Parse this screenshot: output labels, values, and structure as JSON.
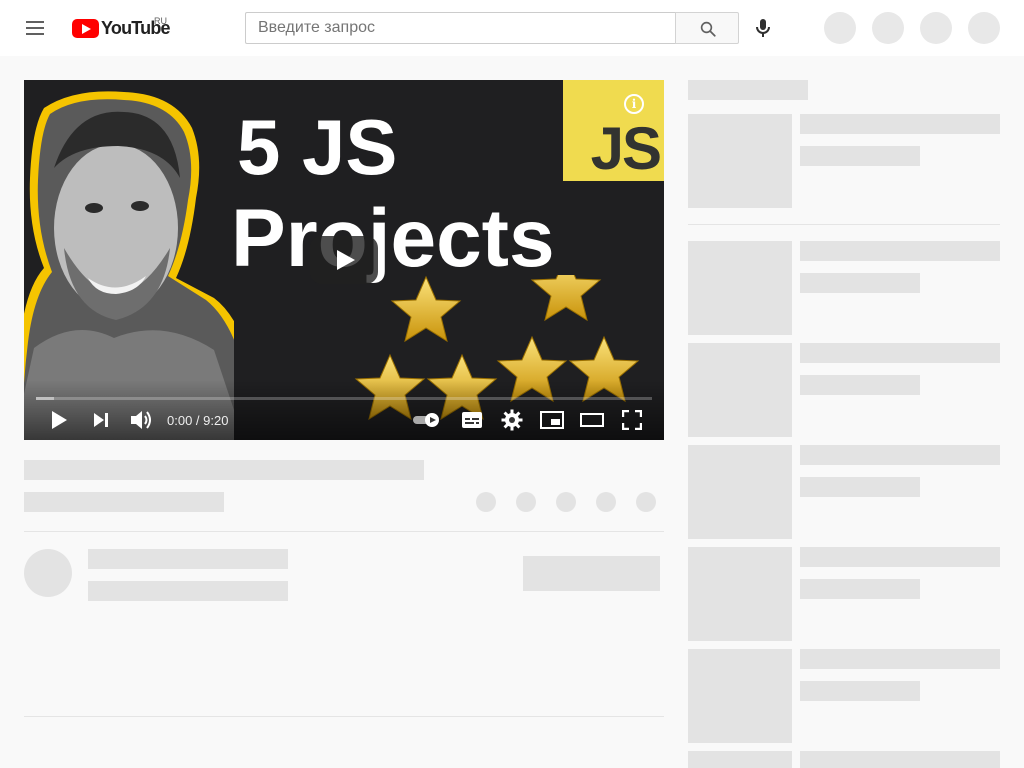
{
  "masthead": {
    "logo_text": "YouTube",
    "region": "RU",
    "search_placeholder": "Введите запрос"
  },
  "player": {
    "thumbnail": {
      "line1": "5 JS",
      "line2": "Projects",
      "badge": "JS",
      "info": "i"
    },
    "time_current": "0:00",
    "time_separator": " / ",
    "time_total": "9:20",
    "progress": 0.03
  },
  "icons": {
    "menu": "menu-icon",
    "search": "search-icon",
    "mic": "mic-icon",
    "play": "play-icon",
    "next": "next-icon",
    "volume": "volume-icon",
    "autoplay": "autoplay-toggle-icon",
    "subtitles": "subtitles-icon",
    "settings": "gear-icon",
    "miniplayer": "miniplayer-icon",
    "theater": "theater-icon",
    "fullscreen": "fullscreen-icon"
  },
  "colors": {
    "brand_red": "#ff0000",
    "js_yellow": "#f0db4f",
    "placeholder": "#e3e3e3",
    "page_bg": "#f9f9f9"
  }
}
